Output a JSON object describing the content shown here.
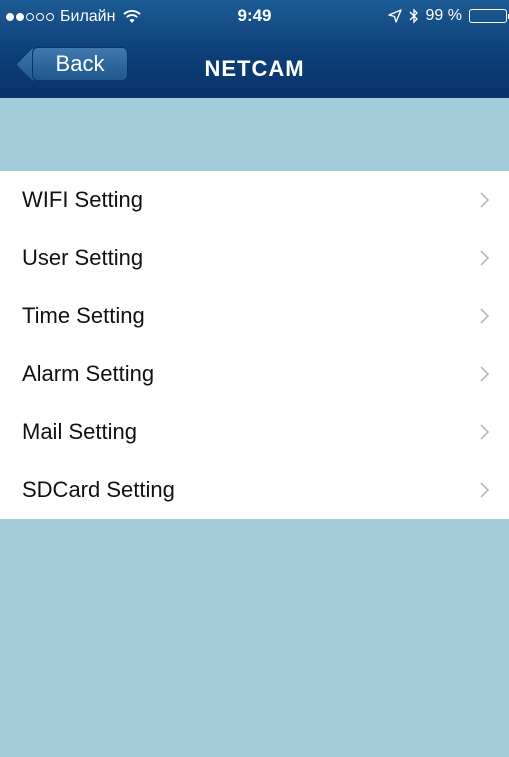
{
  "status_bar": {
    "carrier": "Билайн",
    "time": "9:49",
    "battery_text": "99 %",
    "battery_level": 0.99,
    "signal_bars_filled": 2,
    "signal_bars_total": 5
  },
  "navbar": {
    "back_label": "Back",
    "title": "NETCAM"
  },
  "settings": [
    {
      "label": "WIFI Setting"
    },
    {
      "label": "User Setting"
    },
    {
      "label": "Time Setting"
    },
    {
      "label": "Alarm Setting"
    },
    {
      "label": "Mail Setting"
    },
    {
      "label": "SDCard Setting"
    }
  ],
  "colors": {
    "background": "#a4cbd9",
    "navbar": "#0d3f78",
    "chevron": "#b8b8b8"
  }
}
